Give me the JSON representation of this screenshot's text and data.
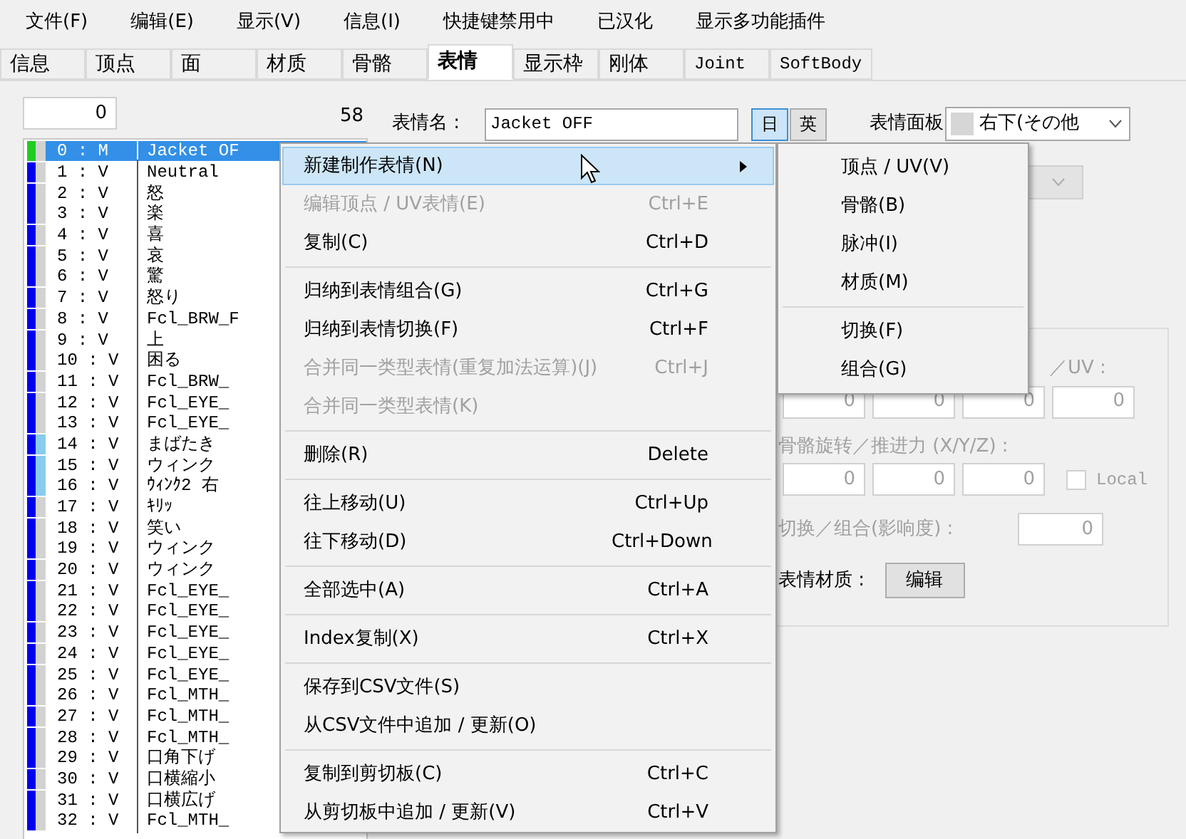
{
  "menu_bar": [
    "文件(F)",
    "编辑(E)",
    "显示(V)",
    "信息(I)",
    "快捷键禁用中",
    "已汉化",
    "显示多功能插件"
  ],
  "tabs": [
    {
      "label": "信息",
      "selected": false,
      "kind": "cjk"
    },
    {
      "label": "顶点",
      "selected": false,
      "kind": "cjk"
    },
    {
      "label": "面",
      "selected": false,
      "kind": "cjk"
    },
    {
      "label": "材质",
      "selected": false,
      "kind": "cjk"
    },
    {
      "label": "骨骼",
      "selected": false,
      "kind": "cjk"
    },
    {
      "label": "表情",
      "selected": true,
      "kind": "cjk"
    },
    {
      "label": "显示枠",
      "selected": false,
      "kind": "cjk"
    },
    {
      "label": "刚体",
      "selected": false,
      "kind": "cjk"
    },
    {
      "label": "Joint",
      "selected": false,
      "kind": "latin"
    },
    {
      "label": "SoftBody",
      "selected": false,
      "kind": "latin"
    }
  ],
  "morph_list": {
    "count_value": "0",
    "total": "58",
    "rows": [
      {
        "id": "0 : M",
        "name": "Jacket OF",
        "color": "#22cc22",
        "marked": false,
        "selected": true
      },
      {
        "id": "1 : V",
        "name": "Neutral",
        "color": "#0000ee",
        "marked": false,
        "selected": false
      },
      {
        "id": "2 : V",
        "name": "怒",
        "color": "#0000ee",
        "marked": false,
        "selected": false
      },
      {
        "id": "3 : V",
        "name": "楽",
        "color": "#0000ee",
        "marked": false,
        "selected": false
      },
      {
        "id": "4 : V",
        "name": "喜",
        "color": "#0000ee",
        "marked": false,
        "selected": false
      },
      {
        "id": "5 : V",
        "name": "哀",
        "color": "#0000ee",
        "marked": false,
        "selected": false
      },
      {
        "id": "6 : V",
        "name": "驚",
        "color": "#0000ee",
        "marked": false,
        "selected": false
      },
      {
        "id": "7 : V",
        "name": "怒り",
        "color": "#0000ee",
        "marked": false,
        "selected": false
      },
      {
        "id": "8 : V",
        "name": "Fcl_BRW_F",
        "color": "#0000ee",
        "marked": false,
        "selected": false
      },
      {
        "id": "9 : V",
        "name": "上",
        "color": "#0000ee",
        "marked": false,
        "selected": false
      },
      {
        "id": "10 : V",
        "name": "困る",
        "color": "#0000ee",
        "marked": false,
        "selected": false
      },
      {
        "id": "11 : V",
        "name": "Fcl_BRW_",
        "color": "#0000ee",
        "marked": false,
        "selected": false
      },
      {
        "id": "12 : V",
        "name": "Fcl_EYE_",
        "color": "#0000ee",
        "marked": false,
        "selected": false
      },
      {
        "id": "13 : V",
        "name": "Fcl_EYE_",
        "color": "#0000ee",
        "marked": false,
        "selected": false
      },
      {
        "id": "14 : V",
        "name": "まばたき",
        "color": "#0000ee",
        "marked": true,
        "selected": false
      },
      {
        "id": "15 : V",
        "name": "ウィンク",
        "color": "#0000ee",
        "marked": true,
        "selected": false
      },
      {
        "id": "16 : V",
        "name": "ｳｨﾝｸ2 右",
        "color": "#0000ee",
        "marked": true,
        "selected": false
      },
      {
        "id": "17 : V",
        "name": "ｷﾘｯ",
        "color": "#0000ee",
        "marked": false,
        "selected": false
      },
      {
        "id": "18 : V",
        "name": "笑い",
        "color": "#0000ee",
        "marked": false,
        "selected": false
      },
      {
        "id": "19 : V",
        "name": "ウィンク",
        "color": "#0000ee",
        "marked": false,
        "selected": false
      },
      {
        "id": "20 : V",
        "name": "ウィンク",
        "color": "#0000ee",
        "marked": false,
        "selected": false
      },
      {
        "id": "21 : V",
        "name": "Fcl_EYE_",
        "color": "#0000ee",
        "marked": false,
        "selected": false
      },
      {
        "id": "22 : V",
        "name": "Fcl_EYE_",
        "color": "#0000ee",
        "marked": false,
        "selected": false
      },
      {
        "id": "23 : V",
        "name": "Fcl_EYE_",
        "color": "#0000ee",
        "marked": false,
        "selected": false
      },
      {
        "id": "24 : V",
        "name": "Fcl_EYE_",
        "color": "#0000ee",
        "marked": false,
        "selected": false
      },
      {
        "id": "25 : V",
        "name": "Fcl_EYE_",
        "color": "#0000ee",
        "marked": false,
        "selected": false
      },
      {
        "id": "26 : V",
        "name": "Fcl_MTH_",
        "color": "#0000ee",
        "marked": false,
        "selected": false
      },
      {
        "id": "27 : V",
        "name": "Fcl_MTH_",
        "color": "#0000ee",
        "marked": false,
        "selected": false
      },
      {
        "id": "28 : V",
        "name": "Fcl_MTH_",
        "color": "#0000ee",
        "marked": false,
        "selected": false
      },
      {
        "id": "29 : V",
        "name": "口角下げ",
        "color": "#0000ee",
        "marked": false,
        "selected": false
      },
      {
        "id": "30 : V",
        "name": "口横縮小",
        "color": "#0000ee",
        "marked": false,
        "selected": false
      },
      {
        "id": "31 : V",
        "name": "口横広げ",
        "color": "#0000ee",
        "marked": false,
        "selected": false
      },
      {
        "id": "32 : V",
        "name": "Fcl_MTH_",
        "color": "#0000ee",
        "marked": false,
        "selected": false
      }
    ]
  },
  "morph_panel": {
    "name_label": "表情名 :",
    "name_value": "Jacket OFF",
    "language_buttons": [
      {
        "label": "日",
        "selected": true
      },
      {
        "label": "英",
        "selected": false
      }
    ],
    "panel_label": "表情面板",
    "panel_value": "右下(その他",
    "offset_label": "／UV :",
    "offset_values": [
      "0",
      "0",
      "0",
      "0"
    ],
    "bone_label": "骨骼旋转／推进力 (X/Y/Z) :",
    "bone_values": [
      "0",
      "0",
      "0"
    ],
    "local": {
      "label": "Local",
      "checked": false
    },
    "weight_label": "切换／组合(影响度) :",
    "weight_value": "0",
    "material_label": "表情材质 :",
    "material_button": "编辑"
  },
  "context_menu": {
    "items": [
      {
        "kind": "item",
        "label": "新建制作表情(N)",
        "disabled": false,
        "selected": true,
        "submenu": true
      },
      {
        "kind": "item",
        "label": "编辑顶点 / UV表情(E)",
        "shortcut": "Ctrl+E",
        "disabled": true,
        "selected": false,
        "submenu": false
      },
      {
        "kind": "item",
        "label": "复制(C)",
        "shortcut": "Ctrl+D",
        "disabled": false,
        "selected": false,
        "submenu": false
      },
      {
        "kind": "separator"
      },
      {
        "kind": "item",
        "label": "归纳到表情组合(G)",
        "shortcut": "Ctrl+G",
        "disabled": false,
        "selected": false,
        "submenu": false
      },
      {
        "kind": "item",
        "label": "归纳到表情切换(F)",
        "shortcut": "Ctrl+F",
        "disabled": false,
        "selected": false,
        "submenu": false
      },
      {
        "kind": "item",
        "label": "合并同一类型表情(重复加法运算)(J)",
        "shortcut": "Ctrl+J",
        "disabled": true,
        "selected": false,
        "submenu": false
      },
      {
        "kind": "item",
        "label": "合并同一类型表情(K)",
        "disabled": true,
        "selected": false,
        "submenu": false
      },
      {
        "kind": "separator"
      },
      {
        "kind": "item",
        "label": "删除(R)",
        "shortcut": "Delete",
        "disabled": false,
        "selected": false,
        "submenu": false
      },
      {
        "kind": "separator"
      },
      {
        "kind": "item",
        "label": "往上移动(U)",
        "shortcut": "Ctrl+Up",
        "disabled": false,
        "selected": false,
        "submenu": false
      },
      {
        "kind": "item",
        "label": "往下移动(D)",
        "shortcut": "Ctrl+Down",
        "disabled": false,
        "selected": false,
        "submenu": false
      },
      {
        "kind": "separator"
      },
      {
        "kind": "item",
        "label": "全部选中(A)",
        "shortcut": "Ctrl+A",
        "disabled": false,
        "selected": false,
        "submenu": false
      },
      {
        "kind": "separator"
      },
      {
        "kind": "item",
        "label": "Index复制(X)",
        "shortcut": "Ctrl+X",
        "disabled": false,
        "selected": false,
        "submenu": false
      },
      {
        "kind": "separator"
      },
      {
        "kind": "item",
        "label": "保存到CSV文件(S)",
        "disabled": false,
        "selected": false,
        "submenu": false
      },
      {
        "kind": "item",
        "label": "从CSV文件中追加 / 更新(O)",
        "disabled": false,
        "selected": false,
        "submenu": false
      },
      {
        "kind": "separator"
      },
      {
        "kind": "item",
        "label": "复制到剪切板(C)",
        "shortcut": "Ctrl+C",
        "disabled": false,
        "selected": false,
        "submenu": false
      },
      {
        "kind": "item",
        "label": "从剪切板中追加 / 更新(V)",
        "shortcut": "Ctrl+V",
        "disabled": false,
        "selected": false,
        "submenu": false
      }
    ]
  },
  "submenu": {
    "items": [
      {
        "kind": "item",
        "label": "顶点 / UV(V)"
      },
      {
        "kind": "item",
        "label": "骨骼(B)"
      },
      {
        "kind": "item",
        "label": "脉冲(I)"
      },
      {
        "kind": "item",
        "label": "材质(M)"
      },
      {
        "kind": "separator"
      },
      {
        "kind": "item",
        "label": "切换(F)"
      },
      {
        "kind": "item",
        "label": "组合(G)"
      }
    ]
  }
}
